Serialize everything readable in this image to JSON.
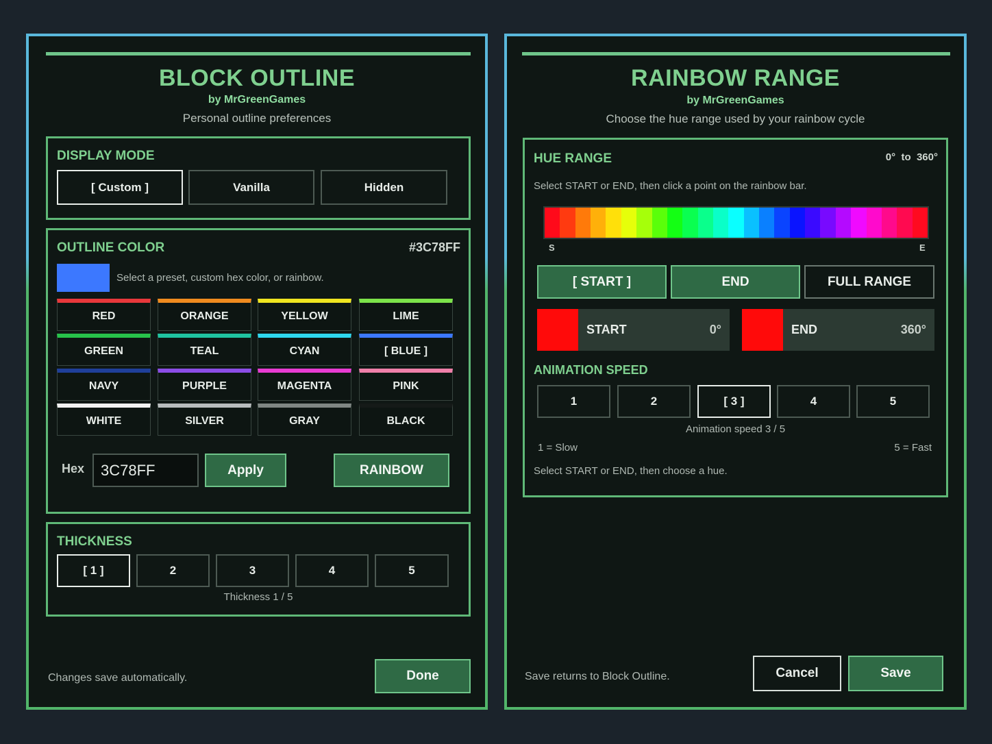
{
  "block_outline": {
    "title": "BLOCK OUTLINE",
    "author": "by MrGreenGames",
    "subtitle": "Personal outline preferences",
    "display_mode": {
      "heading": "DISPLAY MODE",
      "options": [
        "[ Custom ]",
        "Vanilla",
        "Hidden"
      ],
      "selected": "[ Custom ]"
    },
    "outline_color": {
      "heading": "OUTLINE COLOR",
      "hex_display": "#3C78FF",
      "swatch_color": "#3c78ff",
      "hint": "Select a preset, custom hex color, or rainbow.",
      "presets": [
        {
          "label": "RED",
          "color": "#e8383b"
        },
        {
          "label": "ORANGE",
          "color": "#f08b1f"
        },
        {
          "label": "YELLOW",
          "color": "#f0e520"
        },
        {
          "label": "LIME",
          "color": "#7ce34a"
        },
        {
          "label": "GREEN",
          "color": "#27c24a"
        },
        {
          "label": "TEAL",
          "color": "#1fc3a0"
        },
        {
          "label": "CYAN",
          "color": "#2ed7ee"
        },
        {
          "label": "[ BLUE ]",
          "color": "#3c78ff"
        },
        {
          "label": "NAVY",
          "color": "#1f3f9a"
        },
        {
          "label": "PURPLE",
          "color": "#8b4de6"
        },
        {
          "label": "MAGENTA",
          "color": "#e83bd2"
        },
        {
          "label": "PINK",
          "color": "#ef7fa9"
        },
        {
          "label": "WHITE",
          "color": "#f2f2f2"
        },
        {
          "label": "SILVER",
          "color": "#b8bcbd"
        },
        {
          "label": "GRAY",
          "color": "#7f8683"
        },
        {
          "label": "BLACK",
          "color": "#151a18"
        }
      ],
      "hex_label": "Hex",
      "hex_value": "3C78FF",
      "apply_label": "Apply",
      "rainbow_label": "RAINBOW"
    },
    "thickness": {
      "heading": "THICKNESS",
      "options": [
        "[ 1 ]",
        "2",
        "3",
        "4",
        "5"
      ],
      "status": "Thickness 1 / 5"
    },
    "footer_note": "Changes save automatically.",
    "done_label": "Done"
  },
  "rainbow_range": {
    "title": "RAINBOW RANGE",
    "author": "by MrGreenGames",
    "subtitle": "Choose the hue range used by your rainbow cycle",
    "hue_range": {
      "heading": "HUE RANGE",
      "range_text": "0°  to  360°",
      "hint": "Select START or END, then click a point on the rainbow bar.",
      "bar_colors": [
        "#ff0a1a",
        "#ff3a10",
        "#ff7a0a",
        "#ffb00a",
        "#ffe00a",
        "#e6ff0a",
        "#a6ff0a",
        "#5aff0a",
        "#14ff14",
        "#0aff50",
        "#0aff8c",
        "#0affc8",
        "#0affff",
        "#0ac0ff",
        "#0a80ff",
        "#0a44ff",
        "#0a14ff",
        "#3a0aff",
        "#780aff",
        "#b40aff",
        "#f00aff",
        "#ff0acc",
        "#ff0a8c",
        "#ff0a50",
        "#ff0a20"
      ],
      "start_marker": "S",
      "end_marker": "E",
      "buttons": [
        "[ START ]",
        "END",
        "FULL RANGE"
      ],
      "start": {
        "label": "START",
        "value": "0°",
        "color": "#ff0a0a"
      },
      "end": {
        "label": "END",
        "value": "360°",
        "color": "#ff0a0a"
      }
    },
    "animation_speed": {
      "heading": "ANIMATION SPEED",
      "options": [
        "1",
        "2",
        "[ 3 ]",
        "4",
        "5"
      ],
      "status": "Animation speed 3 / 5",
      "slow_label": "1 = Slow",
      "fast_label": "5 = Fast",
      "instruction": "Select START or END, then choose a hue."
    },
    "footer_note": "Save returns to Block Outline.",
    "cancel_label": "Cancel",
    "save_label": "Save"
  }
}
